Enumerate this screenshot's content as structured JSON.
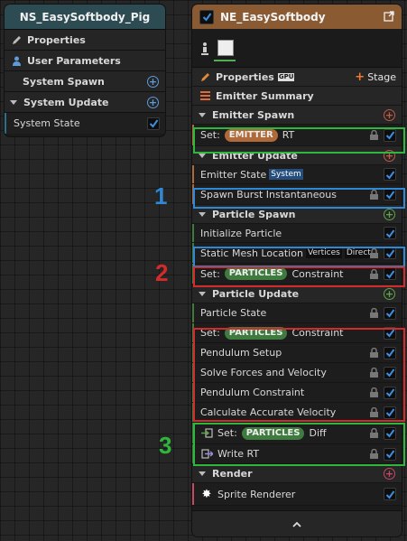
{
  "system_node": {
    "title": "NS_EasySoftbody_Pig",
    "rows": [
      {
        "label": "Properties",
        "icon": "pencil-icon"
      },
      {
        "label": "User Parameters",
        "icon": "user-icon"
      },
      {
        "label": "System Spawn"
      },
      {
        "label": "System Update"
      },
      {
        "label": "System State"
      }
    ]
  },
  "emitter_node": {
    "title": "NE_EasySoftbody",
    "properties_label": "Properties",
    "gpu_badge": "GPU",
    "stage_label": "Stage",
    "summary_label": "Emitter Summary",
    "sections": {
      "emitter_spawn": "Emitter Spawn",
      "emitter_update": "Emitter Update",
      "particle_spawn": "Particle Spawn",
      "particle_update": "Particle Update",
      "render": "Render"
    },
    "items": {
      "set_emitter_prefix": "Set:",
      "set_emitter_pill": "EMITTER",
      "set_emitter_suffix": "RT",
      "emitter_state": "Emitter State",
      "emitter_state_tag": "System",
      "spawn_burst": "Spawn Burst Instantaneous",
      "initialize_particle": "Initialize Particle",
      "static_mesh_location": "Static Mesh Location",
      "sml_tag1": "Vertices",
      "sml_tag2": "Direct",
      "set_particles_prefix": "Set:",
      "set_particles_pill": "PARTICLES",
      "set_particles_suffix": "Constraint",
      "particle_state": "Particle State",
      "set_particles2_prefix": "Set:",
      "set_particles2_pill": "PARTICLES",
      "set_particles2_suffix": "Constraint",
      "pendulum_setup": "Pendulum Setup",
      "solve_forces": "Solve Forces and Velocity",
      "pendulum_constraint": "Pendulum Constraint",
      "calc_velocity": "Calculate Accurate Velocity",
      "set_diff_prefix": "Set:",
      "set_diff_pill": "PARTICLES",
      "set_diff_suffix": "Diff",
      "write_rt": "Write RT",
      "sprite_renderer": "Sprite Renderer"
    }
  },
  "annotations": {
    "n1": "1",
    "n2": "2",
    "n3": "3"
  },
  "colors": {
    "system_title": "#2d4b52",
    "emitter_title": "#8a5a33",
    "highlight_green": "#2fb63d",
    "highlight_blue": "#2f88d4",
    "highlight_red": "#d32b2b",
    "checkbox_blue": "#3b8ee0"
  }
}
